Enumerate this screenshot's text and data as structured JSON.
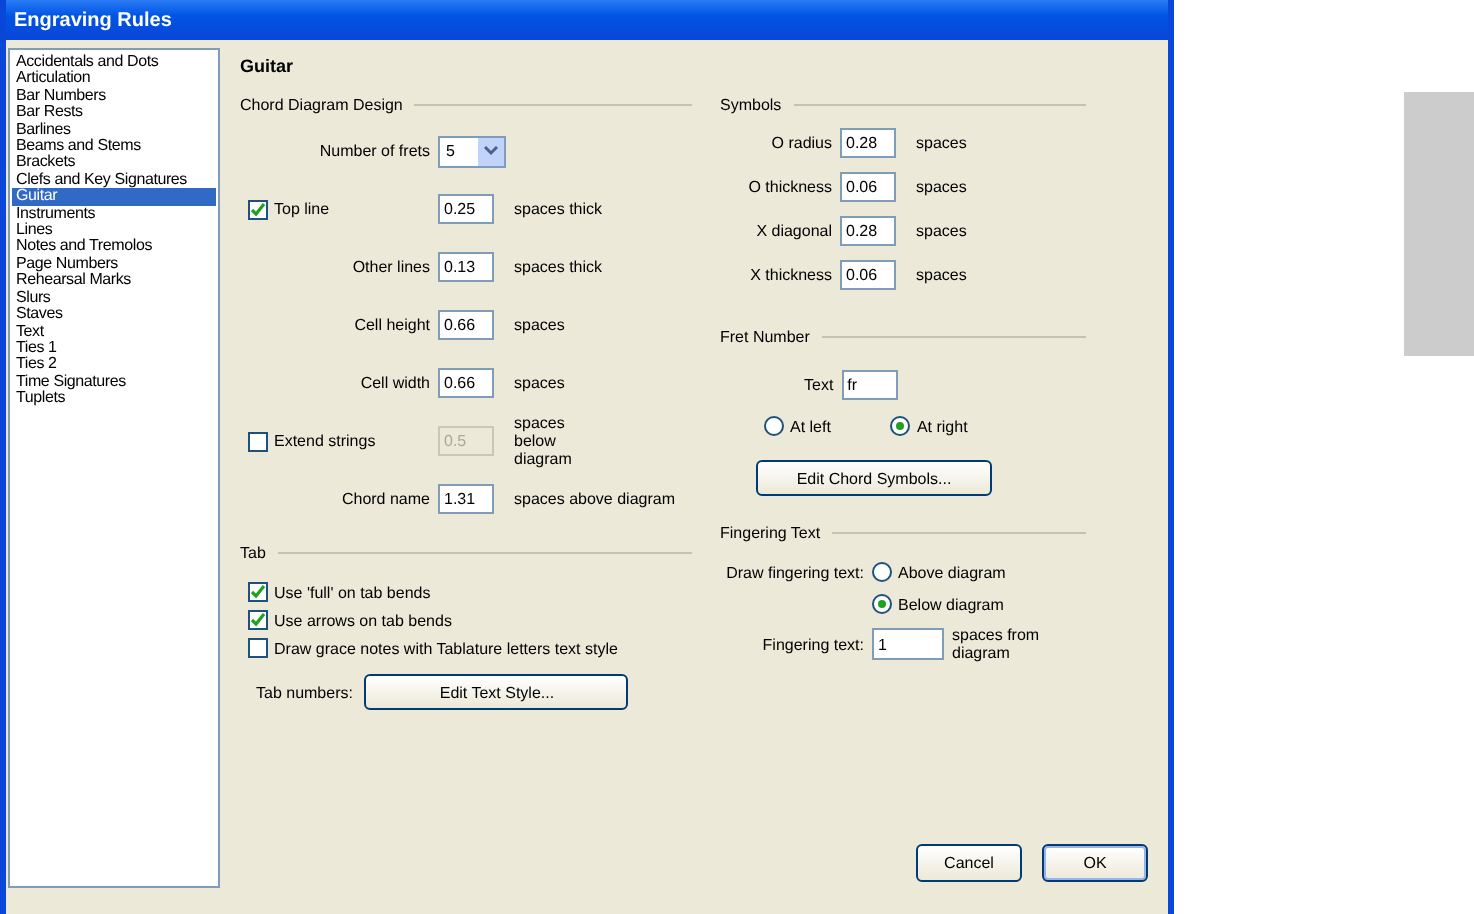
{
  "window": {
    "title": "Engraving Rules"
  },
  "sidebar": {
    "items": [
      {
        "label": "Accidentals and Dots",
        "selected": false
      },
      {
        "label": "Articulation",
        "selected": false
      },
      {
        "label": "Bar Numbers",
        "selected": false
      },
      {
        "label": "Bar Rests",
        "selected": false
      },
      {
        "label": "Barlines",
        "selected": false
      },
      {
        "label": "Beams and Stems",
        "selected": false
      },
      {
        "label": "Brackets",
        "selected": false
      },
      {
        "label": "Clefs and Key Signatures",
        "selected": false
      },
      {
        "label": "Guitar",
        "selected": true
      },
      {
        "label": "Instruments",
        "selected": false
      },
      {
        "label": "Lines",
        "selected": false
      },
      {
        "label": "Notes and Tremolos",
        "selected": false
      },
      {
        "label": "Page Numbers",
        "selected": false
      },
      {
        "label": "Rehearsal Marks",
        "selected": false
      },
      {
        "label": "Slurs",
        "selected": false
      },
      {
        "label": "Staves",
        "selected": false
      },
      {
        "label": "Text",
        "selected": false
      },
      {
        "label": "Ties 1",
        "selected": false
      },
      {
        "label": "Ties 2",
        "selected": false
      },
      {
        "label": "Time Signatures",
        "selected": false
      },
      {
        "label": "Tuplets",
        "selected": false
      }
    ]
  },
  "page_title": "Guitar",
  "chord_diagram": {
    "heading": "Chord Diagram Design",
    "rows": [
      {
        "kind": "select",
        "label": "Number of frets",
        "value": "5"
      },
      {
        "kind": "check-field",
        "label": "Top line",
        "checked": true,
        "disabled": false,
        "value": "0.25",
        "unit": "spaces thick"
      },
      {
        "kind": "field",
        "label": "Other lines",
        "value": "0.13",
        "unit": "spaces thick"
      },
      {
        "kind": "field",
        "label": "Cell height",
        "value": "0.66",
        "unit": "spaces"
      },
      {
        "kind": "field",
        "label": "Cell width",
        "value": "0.66",
        "unit": "spaces"
      },
      {
        "kind": "check-field",
        "label": "Extend strings",
        "checked": false,
        "disabled": true,
        "value": "0.5",
        "unit": "spaces below diagram"
      },
      {
        "kind": "field",
        "label": "Chord name",
        "value": "1.31",
        "unit": "spaces above diagram"
      }
    ]
  },
  "tab": {
    "heading": "Tab",
    "checkboxes": [
      {
        "label": "Use 'full' on tab bends",
        "checked": true
      },
      {
        "label": "Use arrows on tab bends",
        "checked": true
      },
      {
        "label": "Draw grace notes with Tablature letters text style",
        "checked": false
      }
    ],
    "numbers_label": "Tab numbers:",
    "button": "Edit Text Style..."
  },
  "symbols": {
    "heading": "Symbols",
    "rows": [
      {
        "label": "O radius",
        "value": "0.28",
        "unit": "spaces"
      },
      {
        "label": "O thickness",
        "value": "0.06",
        "unit": "spaces"
      },
      {
        "label": "X diagonal",
        "value": "0.28",
        "unit": "spaces"
      },
      {
        "label": "X thickness",
        "value": "0.06",
        "unit": "spaces"
      }
    ]
  },
  "fret_number": {
    "heading": "Fret Number",
    "text_label": "Text",
    "text_value": "fr",
    "radios": [
      {
        "label": "At left",
        "selected": false
      },
      {
        "label": "At right",
        "selected": true
      }
    ],
    "button": "Edit Chord Symbols..."
  },
  "fingering_text": {
    "heading": "Fingering Text",
    "draw_label": "Draw fingering text:",
    "radios": [
      {
        "label": "Above diagram",
        "selected": false
      },
      {
        "label": "Below diagram",
        "selected": true
      }
    ],
    "field_label": "Fingering text:",
    "field_value": "1",
    "field_unit": "spaces from diagram"
  },
  "buttons": [
    {
      "label": "Cancel",
      "default": false
    },
    {
      "label": "OK",
      "default": true
    }
  ]
}
